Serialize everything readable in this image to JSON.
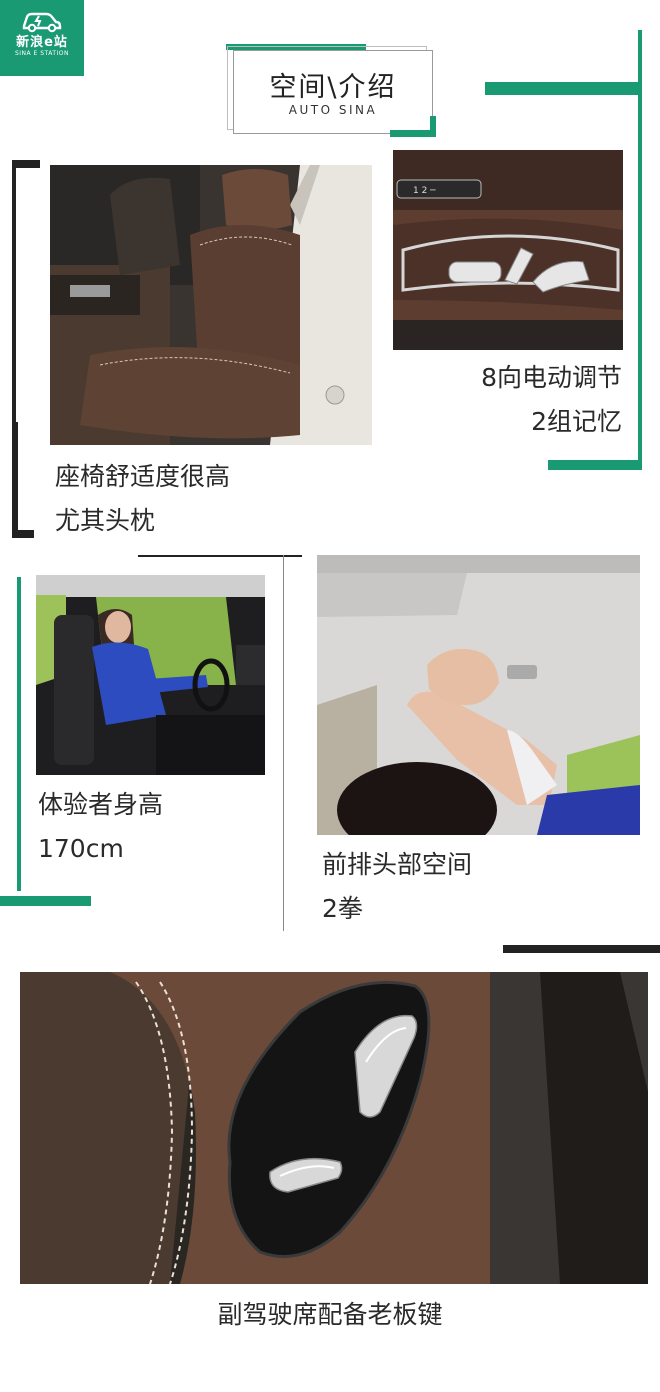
{
  "logo": {
    "name": "新浪e站",
    "sub": "SINA E STATION"
  },
  "header": {
    "title": "空间\\介绍",
    "subtitle": "AUTO SINA"
  },
  "captions": {
    "seat_comfort": [
      "座椅舒适度很高",
      "尤其头枕"
    ],
    "power_adjust": [
      "8向电动调节",
      "2组记忆"
    ],
    "tester_height": [
      "体验者身高",
      "170cm"
    ],
    "front_headroom": [
      "前排头部空间",
      "2拳"
    ],
    "boss_key": "副驾驶席配备老板键"
  },
  "colors": {
    "accent": "#1a9a72",
    "leather_brown": "#6b4a3a",
    "line_dark": "#222222"
  }
}
